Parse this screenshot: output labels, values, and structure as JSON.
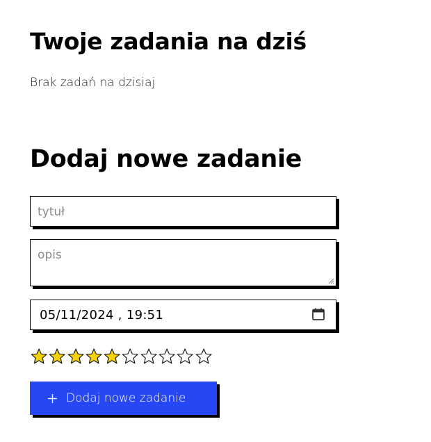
{
  "today": {
    "heading": "Twoje zadania na dziś",
    "empty_message": "Brak zadań na dzisiaj"
  },
  "new_task": {
    "heading": "Dodaj nowe zadanie",
    "title_placeholder": "tytuł",
    "description_placeholder": "opis",
    "datetime_value": "05/11/2024 , 19:51",
    "priority": {
      "filled": 5,
      "total": 10,
      "filled_color": "#f5d20a",
      "empty_color": "#ffffff"
    },
    "submit_label": "Dodaj nowe zadanie",
    "submit_icon": "plus-icon",
    "accent_color": "#2747f5"
  }
}
